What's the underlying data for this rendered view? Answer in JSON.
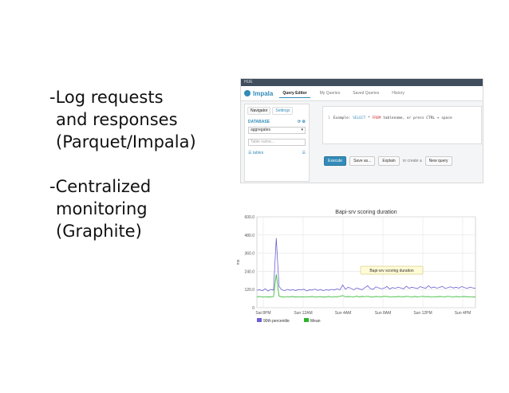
{
  "bullets": [
    {
      "lines": [
        "-Log requests",
        "and responses",
        "(Parquet/Impala)"
      ]
    },
    {
      "lines": [
        "-Centralized",
        "monitoring",
        "(Graphite)"
      ]
    }
  ],
  "impala": {
    "topbar_text": "HUE",
    "brand": "Impala",
    "tabs": [
      "Query Editor",
      "My Queries",
      "Saved Queries",
      "History"
    ],
    "nav_tabs": [
      "Navigator",
      "Settings"
    ],
    "database_label": "DATABASE",
    "database_value": "aggregates",
    "filter_placeholder": "Table name...",
    "tables_label": "tables",
    "editor_line": "1",
    "editor_prefix": "Example: ",
    "editor_kw1": "SELECT",
    "editor_mid": " * ",
    "editor_kw2": "FROM",
    "editor_rest": " tablename, or press CTRL + space",
    "execute_label": "Execute",
    "save_label": "Save as...",
    "explain_label": "Explain",
    "or_text": "or create a",
    "new_query_label": "New query",
    "brand_color": "#338bb8"
  },
  "chart_data": {
    "type": "line",
    "title": "Bapi-srv scoring duration",
    "ylabel": "ms",
    "ylim": [
      0,
      600
    ],
    "yticks": [
      0,
      120,
      240,
      360,
      480,
      600
    ],
    "ytick_labels": [
      "0",
      "120.0",
      "240.0",
      "360.0",
      "480.0",
      "600.0"
    ],
    "xticks": [
      "Sat 8PM",
      "Sun 12AM",
      "Sun 4AM",
      "Sun 8AM",
      "Sun 12PM",
      "Sun 4PM"
    ],
    "x": [
      0,
      1,
      2,
      3,
      4,
      5,
      6,
      7,
      8,
      9,
      10,
      11,
      12,
      13,
      14,
      15,
      16,
      17,
      18,
      19,
      20,
      21,
      22,
      23,
      24,
      25,
      26,
      27,
      28,
      29,
      30,
      31,
      32,
      33,
      34,
      35,
      36,
      37,
      38,
      39,
      40,
      41,
      42,
      43,
      44,
      45,
      46,
      47,
      48,
      49,
      50,
      51,
      52,
      53,
      54,
      55,
      56,
      57,
      58,
      59,
      60,
      61,
      62,
      63,
      64,
      65,
      66,
      67,
      68,
      69,
      70,
      71,
      72,
      73,
      74,
      75,
      76,
      77,
      78,
      79
    ],
    "series": [
      {
        "name": "90th percentile",
        "color": "#6b5fd6",
        "values": [
          115,
          118,
          112,
          125,
          110,
          120,
          116,
          460,
          140,
          118,
          112,
          121,
          115,
          119,
          113,
          120,
          117,
          122,
          110,
          118,
          116,
          123,
          114,
          120,
          112,
          119,
          115,
          121,
          117,
          125,
          118,
          150,
          122,
          135,
          128,
          118,
          130,
          124,
          119,
          132,
          145,
          126,
          121,
          138,
          131,
          125,
          129,
          140,
          123,
          133,
          127,
          136,
          130,
          124,
          142,
          128,
          135,
          131,
          126,
          139,
          133,
          128,
          145,
          130,
          137,
          129,
          134,
          141,
          127,
          132,
          138,
          130,
          135,
          129,
          140,
          133,
          127,
          136,
          131,
          128
        ]
      },
      {
        "name": "Mean",
        "color": "#2cb52c",
        "values": [
          72,
          74,
          71,
          73,
          70,
          72,
          73,
          220,
          76,
          72,
          71,
          73,
          72,
          74,
          70,
          73,
          72,
          71,
          73,
          72,
          74,
          71,
          72,
          73,
          70,
          72,
          74,
          71,
          73,
          72,
          75,
          80,
          72,
          74,
          73,
          71,
          76,
          72,
          74,
          73,
          75,
          72,
          71,
          74,
          73,
          72,
          75,
          74,
          71,
          73,
          72,
          74,
          73,
          72,
          75,
          73,
          71,
          74,
          72,
          73,
          75,
          72,
          74,
          71,
          73,
          72,
          74,
          73,
          72,
          75,
          73,
          71,
          74,
          72,
          73,
          74,
          72,
          73,
          71,
          72
        ]
      }
    ],
    "tooltip": "Bapi-srv scoring duration",
    "legend_placement": "bottom-left",
    "grid": true
  }
}
